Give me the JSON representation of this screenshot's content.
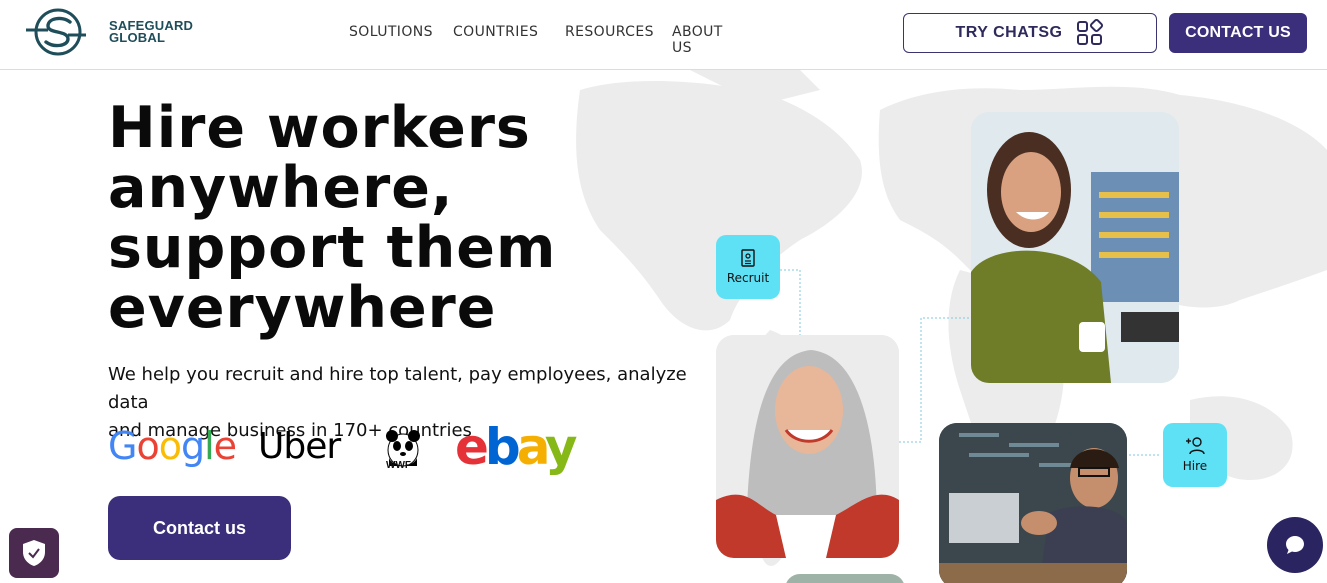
{
  "brand": {
    "name_line1": "SAFEGUARD",
    "name_line2": "GLOBAL"
  },
  "nav": {
    "items": [
      {
        "label": "SOLUTIONS"
      },
      {
        "label": "COUNTRIES"
      },
      {
        "label": "RESOURCES"
      },
      {
        "label": "ABOUT US"
      }
    ]
  },
  "header_actions": {
    "try_label": "TRY CHATSG",
    "try_icon": "apps-grid-icon",
    "contact_label": "CONTACT US"
  },
  "hero": {
    "title_lines": [
      "Hire workers",
      "anywhere,",
      "support them",
      "everywhere"
    ],
    "subtitle_line1": "We help you recruit and hire top talent, pay employees, analyze data",
    "subtitle_line2": "and manage business in 170+ countries",
    "cta_label": "Contact us"
  },
  "logos": {
    "google": "Google",
    "uber": "Uber",
    "wwf": "WWF",
    "ebay": "ebay"
  },
  "tags": {
    "recruit": "Recruit",
    "hire": "Hire"
  },
  "colors": {
    "primary": "#3b2e7a",
    "accent_cyan": "#5ee1f5",
    "logo_teal": "#1f4e5a"
  }
}
